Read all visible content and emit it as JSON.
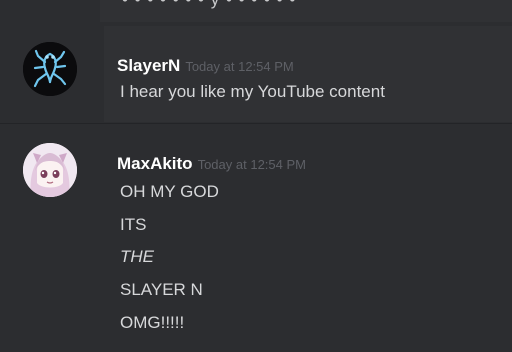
{
  "top_cutoff_text": "• • • • • • • y • • • • • •",
  "messages": [
    {
      "username": "SlayerN",
      "timestamp": "Today at 12:54 PM",
      "lines": [
        "I hear you like my YouTube content"
      ]
    },
    {
      "username": "MaxAkito",
      "timestamp": "Today at 12:54 PM",
      "lines": [
        "OH MY GOD",
        "ITS",
        "THE",
        "SLAYER N",
        "OMG!!!!!"
      ]
    }
  ]
}
